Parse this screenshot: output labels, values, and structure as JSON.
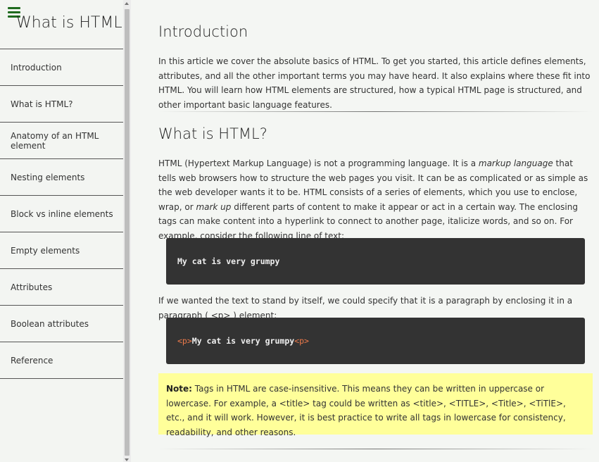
{
  "sidebar": {
    "title": "What is HTML?",
    "items": [
      {
        "label": "Introduction"
      },
      {
        "label": "What is HTML?"
      },
      {
        "label": "Anatomy of an HTML element"
      },
      {
        "label": "Nesting elements"
      },
      {
        "label": "Block vs inline elements"
      },
      {
        "label": "Empty elements"
      },
      {
        "label": "Attributes"
      },
      {
        "label": "Boolean attributes"
      },
      {
        "label": "Reference"
      }
    ]
  },
  "main": {
    "intro": {
      "heading": "Introduction",
      "text": "In this article we cover the absolute basics of HTML. To get you started, this article defines elements, attributes, and all the other important terms you may have heard. It also explains where these fit into HTML. You will learn how HTML elements are structured, how a typical HTML page is structured, and other important basic language features."
    },
    "what": {
      "heading": "What is HTML?",
      "p1_a": "HTML (Hypertext Markup Language) is not a programming language. It is a ",
      "p1_em1": "markup language",
      "p1_b": " that tells web browsers how to structure the web pages you visit. It can be as complicated or as simple as the web developer wants it to be. HTML consists of a series of elements, which you use to enclose, wrap, or ",
      "p1_em2": "mark up",
      "p1_c": " different parts of content to make it appear or act in a certain way. The enclosing tags can make content into a hyperlink to connect to another page, italicize words, and so on. For example, consider the following line of text:",
      "code1": "My cat is very grumpy",
      "p2": "If we wanted the text to stand by itself, we could specify that it is a paragraph by enclosing it in a paragraph ( <p> ) element:",
      "code2_open": "<p>",
      "code2_text": "My cat is very grumpy",
      "code2_close": "<p>",
      "note_label": "Note:",
      "note_text": " Tags in HTML are case-insensitive. This means they can be written in uppercase or lowercase. For example, a <title> tag could be written as <title>, <TITLE>, <Title>, <TiTlE>, etc., and it will work. However, it is best practice to write all tags in lowercase for consistency, readability, and other reasons."
    }
  },
  "colors": {
    "menu_icon": "#1f6b1f",
    "code_bg": "#333333",
    "code_tag": "#ef7b4b",
    "note_bg": "#ffff9a"
  },
  "icons": [
    "hamburger-menu-icon",
    "scroll-up-arrow-icon",
    "scroll-down-arrow-icon"
  ]
}
